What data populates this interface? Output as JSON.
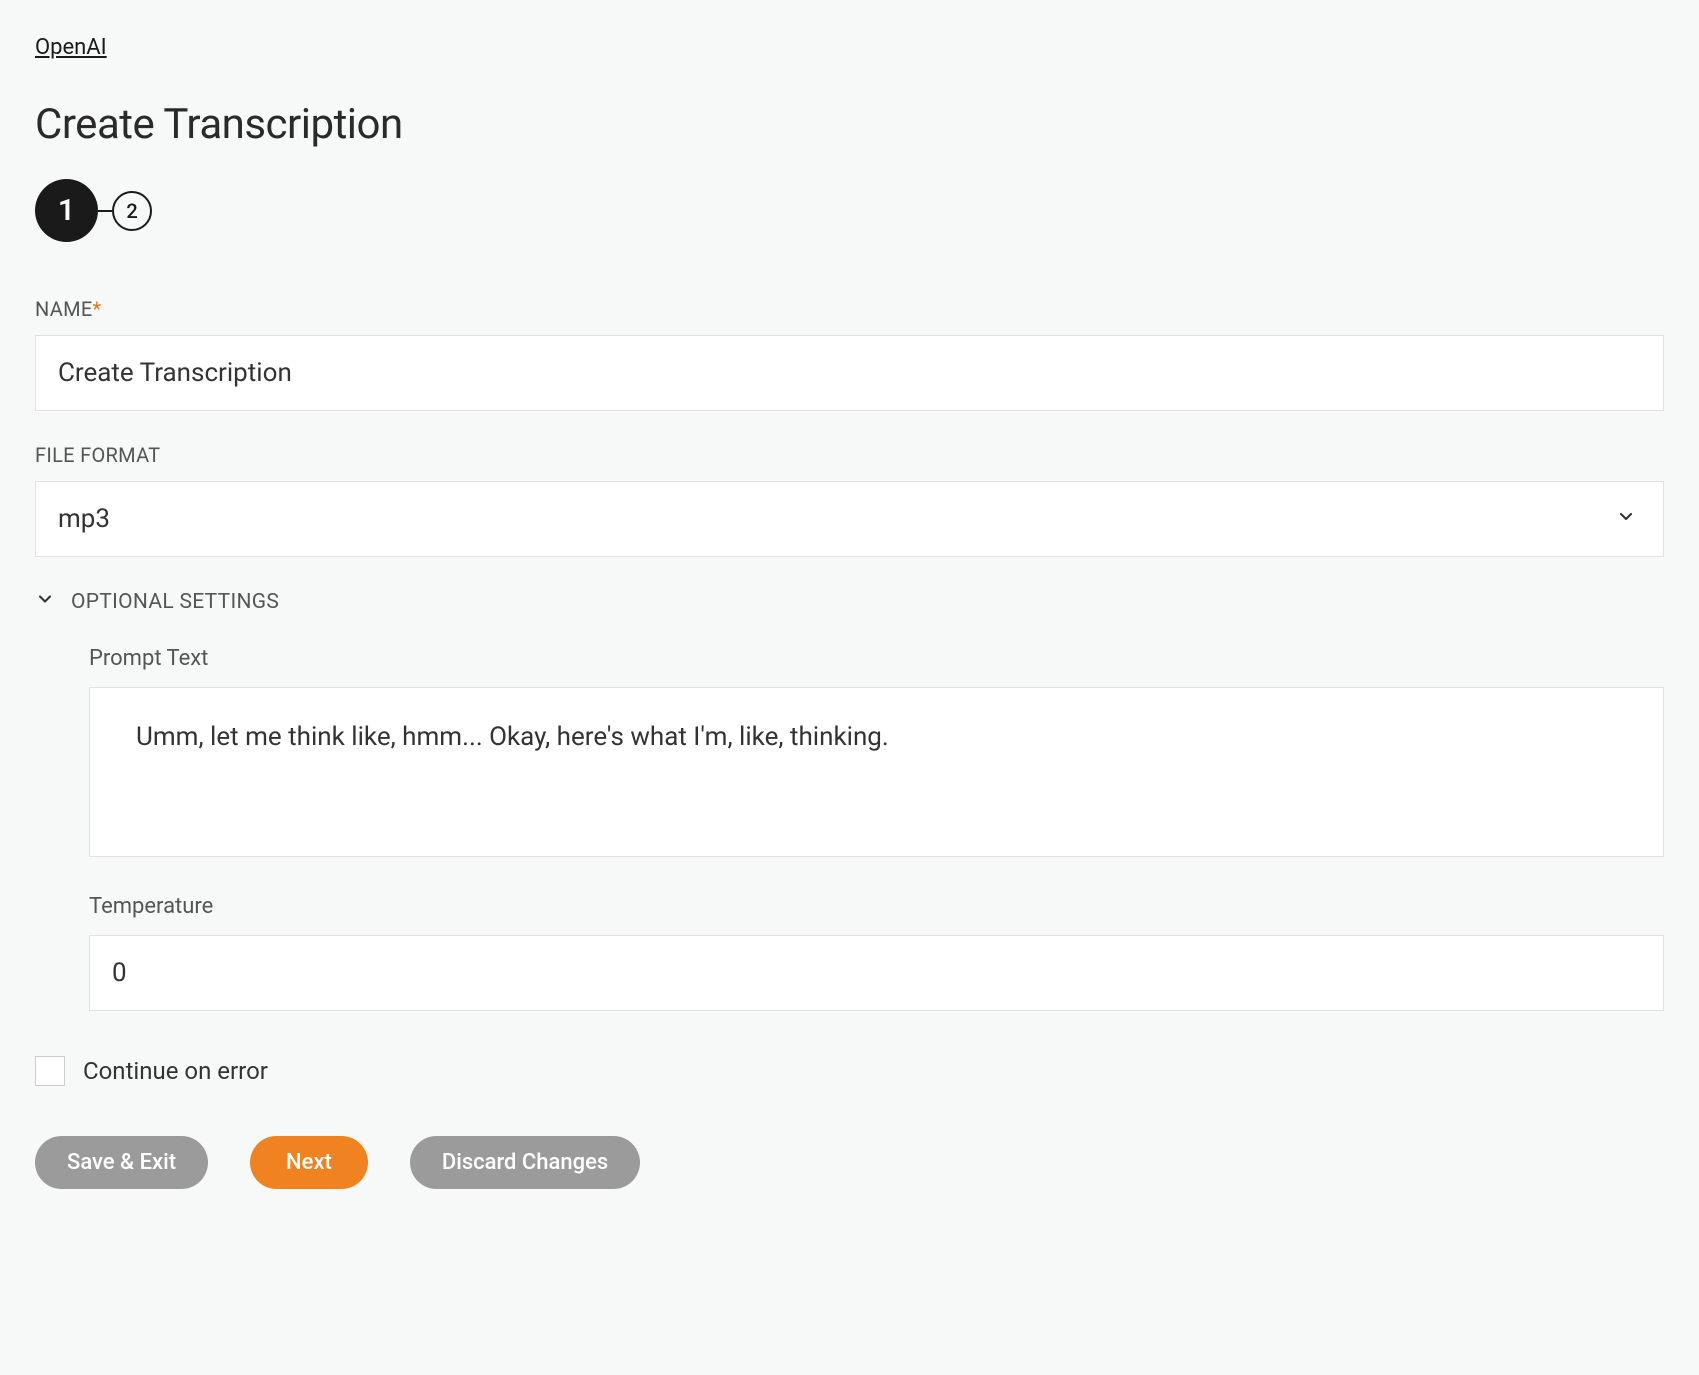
{
  "breadcrumb": {
    "label": "OpenAI"
  },
  "page": {
    "title": "Create Transcription"
  },
  "stepper": {
    "step1": "1",
    "step2": "2"
  },
  "form": {
    "name": {
      "label": "NAME",
      "value": "Create Transcription"
    },
    "fileFormat": {
      "label": "FILE FORMAT",
      "value": "mp3"
    },
    "optional": {
      "header": "OPTIONAL SETTINGS",
      "promptText": {
        "label": "Prompt Text",
        "value": "Umm, let me think like, hmm... Okay, here's what I'm, like, thinking."
      },
      "temperature": {
        "label": "Temperature",
        "value": "0"
      }
    },
    "continueOnError": {
      "label": "Continue on error"
    }
  },
  "buttons": {
    "saveExit": "Save & Exit",
    "next": "Next",
    "discard": "Discard Changes"
  }
}
